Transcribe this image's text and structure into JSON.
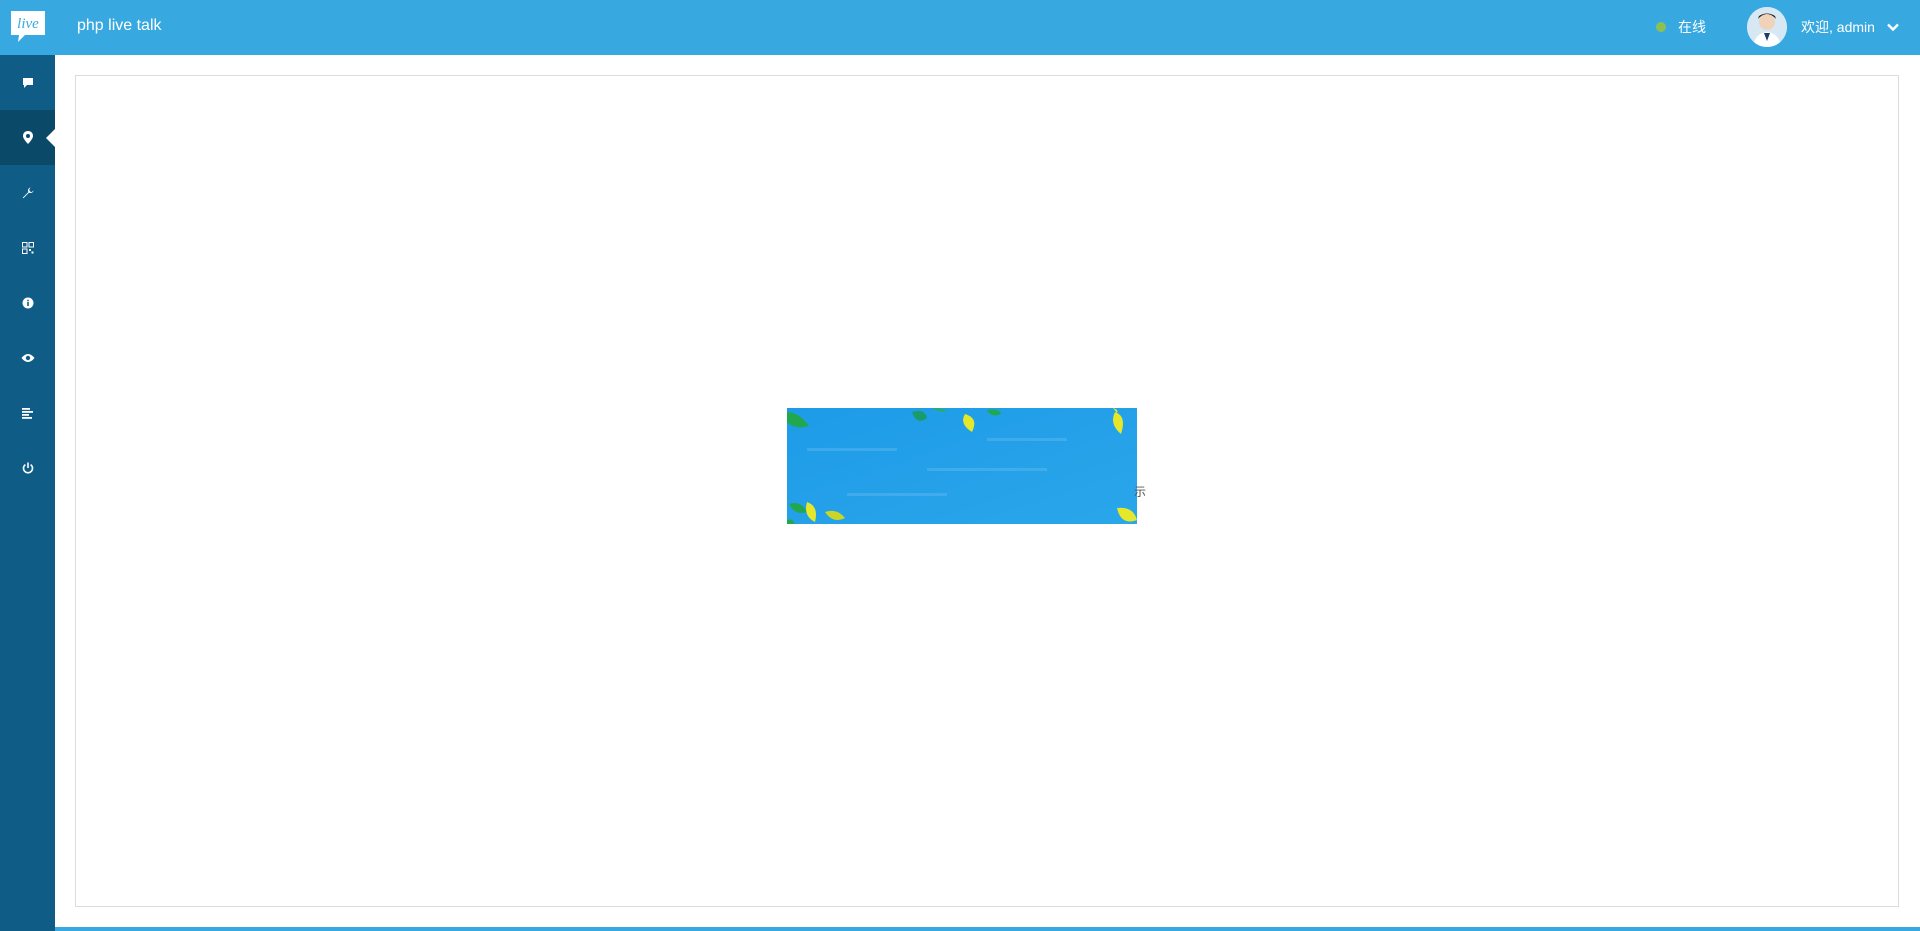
{
  "header": {
    "logo_text": "live",
    "app_title": "php live talk",
    "status_label": "在线",
    "status_color": "#8cc152",
    "user_label": "欢迎, admin",
    "brand_color": "#38a9e0"
  },
  "sidebar": {
    "items": [
      {
        "icon": "chat-icon"
      },
      {
        "icon": "map-marker-icon",
        "active": true
      },
      {
        "icon": "wrench-icon"
      },
      {
        "icon": "qrcode-icon"
      },
      {
        "icon": "info-icon"
      },
      {
        "icon": "eye-icon"
      },
      {
        "icon": "align-left-icon"
      },
      {
        "icon": "power-icon"
      }
    ],
    "bg_color": "#0f5d86"
  },
  "main": {
    "banner_caption": "示"
  }
}
